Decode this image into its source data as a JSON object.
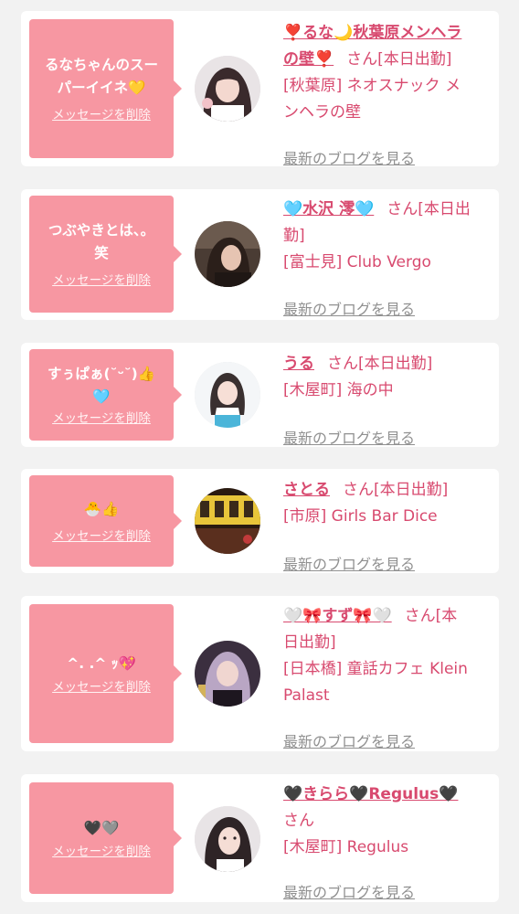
{
  "delete_label": "メッセージを削除",
  "blog_label": "最新のブログを見る",
  "san_label": "さん",
  "cards": [
    {
      "message_lines": [
        "るなちゃんのスー",
        "パーイイネ💛"
      ],
      "name_lines": [
        "❣️るな🌙秋葉原メンヘラ",
        "の壁❣️"
      ],
      "status_inline": "[本日出勤]",
      "shop_lines": [
        "[秋葉原] ネオスナック メ",
        "ンヘラの壁"
      ]
    },
    {
      "message_lines": [
        "つぶやきとは、。",
        "笑"
      ],
      "name_lines": [
        "🩵水沢 澪🩵"
      ],
      "status_lines": [
        "[本日出",
        "勤]"
      ],
      "shop_lines": [
        "[富士見] Club Vergo"
      ]
    },
    {
      "message_lines": [
        "すぅぱぁ(˘ᵕ˘)👍",
        "🩵"
      ],
      "name_lines": [
        "うる"
      ],
      "status_inline": "[本日出勤]",
      "shop_lines": [
        "[木屋町] 海の中"
      ]
    },
    {
      "message_lines": [
        "🐣👍"
      ],
      "name_lines": [
        "さとる"
      ],
      "status_inline": "[本日出勤]",
      "shop_lines": [
        "[市原] Girls Bar Dice"
      ]
    },
    {
      "message_lines": [
        "^. .^ ｯ💖"
      ],
      "name_lines": [
        "🤍🎀すず🎀🤍"
      ],
      "status_lines": [
        "[本",
        "日出勤]"
      ],
      "shop_lines": [
        "[日本橋] 童話カフェ Klein",
        "Palast"
      ]
    },
    {
      "message_lines": [
        "🖤🩶"
      ],
      "name_lines": [
        "🖤きらら🖤Regulus🖤"
      ],
      "status_lines": [
        ""
      ],
      "shop_lines": [
        "[木屋町] Regulus"
      ]
    }
  ],
  "colors": {
    "background": "#f2f2f2",
    "bubble": "#f797a2",
    "accent": "#d84a6f",
    "link_gray": "#909090"
  }
}
